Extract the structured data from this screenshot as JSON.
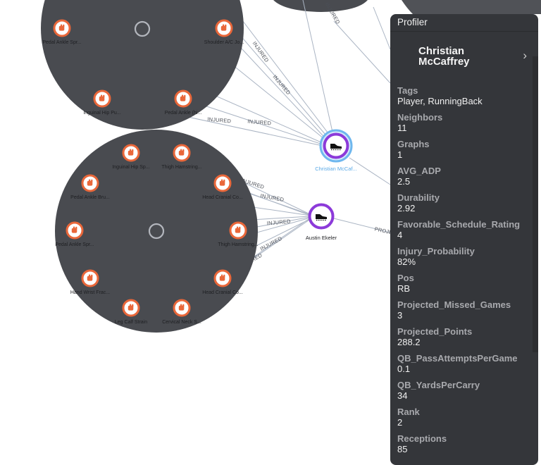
{
  "graph": {
    "edge_label": "INJURED",
    "projected_edge_label": "PROJE",
    "players": [
      {
        "name": "Christian McCaf...",
        "selected": true
      },
      {
        "name": "Austin Ekeler",
        "selected": false
      }
    ],
    "cluster_top": [
      "Pedal Ankle Spr...",
      "Shoulder A/C Jo...",
      "Inguinal Hip Pu...",
      "Pedal Ankle (hi..."
    ],
    "cluster_bottom": [
      "Inguinal Hip Sp...",
      "Thigh Hamstring...",
      "Pedal Ankle Bru...",
      "Head Cranial Co...",
      "Pedal Ankle Spr...",
      "Thigh Hamstring...",
      "Hand Wrist Frac...",
      "Head Cranial Co...",
      "Leg Calf Strain",
      "Cervical Neck S..."
    ]
  },
  "profiler": {
    "title": "Profiler",
    "name": "Christian McCaffrey",
    "fields": [
      {
        "label": "Tags",
        "value": "Player, RunningBack"
      },
      {
        "label": "Neighbors",
        "value": "11"
      },
      {
        "label": "Graphs",
        "value": "1"
      },
      {
        "label": "AVG_ADP",
        "value": "2.5"
      },
      {
        "label": "Durability",
        "value": "2.92"
      },
      {
        "label": "Favorable_Schedule_Rating",
        "value": "4"
      },
      {
        "label": "Injury_Probability",
        "value": "82%"
      },
      {
        "label": "Pos",
        "value": "RB"
      },
      {
        "label": "Projected_Missed_Games",
        "value": "3"
      },
      {
        "label": "Projected_Points",
        "value": "288.2"
      },
      {
        "label": "QB_PassAttemptsPerGame",
        "value": "0.1"
      },
      {
        "label": "QB_YardsPerCarry",
        "value": "34"
      },
      {
        "label": "Rank",
        "value": "2"
      },
      {
        "label": "Receptions",
        "value": "85"
      }
    ]
  },
  "colors": {
    "cluster_fill": "#494b50",
    "injury_ring": "#e9673a",
    "player_ring": "#8c3ad9",
    "selected_halo": "#6fb7ee",
    "edge": "#aab4c3",
    "panel_bg": "#34363a"
  }
}
